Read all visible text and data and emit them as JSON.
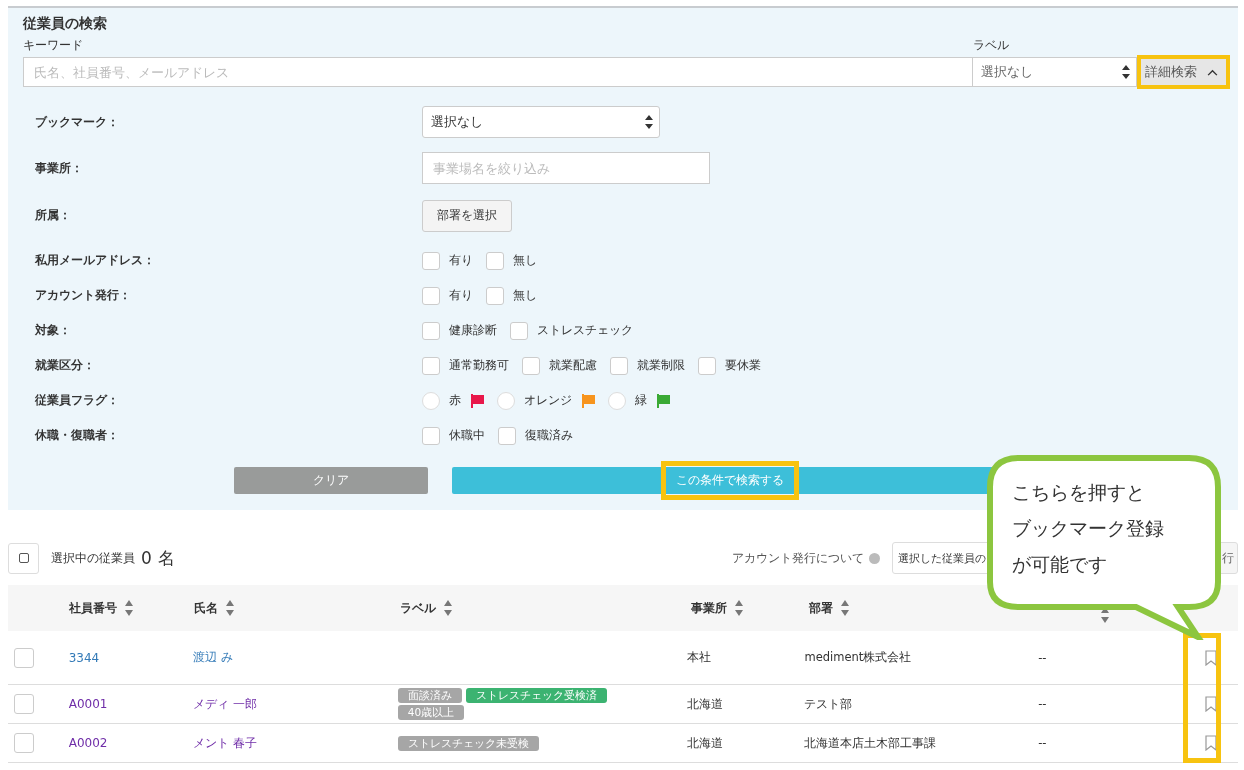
{
  "search_panel": {
    "title": "従業員の検索",
    "keyword": {
      "label": "キーワード",
      "placeholder": "氏名、社員番号、メールアドレス"
    },
    "label_filter": {
      "label": "ラベル",
      "value": "選択なし"
    },
    "detail_toggle": {
      "label": "詳細検索",
      "expanded": true,
      "highlighted": true
    },
    "filters": [
      {
        "kind": "select",
        "label": "ブックマーク：",
        "value": "選択なし"
      },
      {
        "kind": "text",
        "label": "事業所：",
        "placeholder": "事業場名を絞り込み"
      },
      {
        "kind": "button",
        "label": "所属：",
        "button": "部署を選択"
      },
      {
        "kind": "checkboxes",
        "label": "私用メールアドレス：",
        "options": [
          {
            "label": "有り",
            "checked": false
          },
          {
            "label": "無し",
            "checked": false
          }
        ]
      },
      {
        "kind": "checkboxes",
        "label": "アカウント発行：",
        "options": [
          {
            "label": "有り",
            "checked": false
          },
          {
            "label": "無し",
            "checked": false
          }
        ]
      },
      {
        "kind": "checkboxes",
        "label": "対象：",
        "options": [
          {
            "label": "健康診断",
            "checked": false
          },
          {
            "label": "ストレスチェック",
            "checked": false
          }
        ]
      },
      {
        "kind": "checkboxes",
        "label": "就業区分：",
        "options": [
          {
            "label": "通常勤務可",
            "checked": false
          },
          {
            "label": "就業配慮",
            "checked": false
          },
          {
            "label": "就業制限",
            "checked": false
          },
          {
            "label": "要休業",
            "checked": false
          }
        ]
      },
      {
        "kind": "radios",
        "label": "従業員フラグ：",
        "options": [
          {
            "label": "赤",
            "selected": false,
            "color": "#e8174a"
          },
          {
            "label": "オレンジ",
            "selected": false,
            "color": "#f7941d"
          },
          {
            "label": "緑",
            "selected": false,
            "color": "#3aaa35"
          }
        ]
      },
      {
        "kind": "checkboxes",
        "label": "休職・復職者：",
        "options": [
          {
            "label": "休職中",
            "checked": false
          },
          {
            "label": "復職済み",
            "checked": false
          }
        ]
      }
    ],
    "clear_button": "クリア",
    "search_button": {
      "label": "この条件で検索する",
      "highlighted": true
    }
  },
  "results": {
    "select_all_checked": false,
    "selected_label": "選択中の従業員",
    "selected_count": "0",
    "selected_unit": "名",
    "account_help": "アカウント発行について",
    "bulk_select": "選択した従業員の",
    "bulk_button": "行",
    "table": {
      "bookmark_highlighted": true,
      "columns": [
        {
          "label": "社員番号",
          "sortable": true
        },
        {
          "label": "氏名",
          "sortable": true
        },
        {
          "label": "ラベル",
          "sortable": true
        },
        {
          "label": "事業所",
          "sortable": true
        },
        {
          "label": "部署",
          "sortable": true
        },
        {
          "sortable": true
        }
      ],
      "rows": [
        {
          "checked": false,
          "id": "3344",
          "name": "渡辺 み",
          "visited": false,
          "labels": [],
          "office": "本社",
          "department": "mediment株式会社",
          "column_7": "--",
          "bookmarked": false
        },
        {
          "checked": false,
          "id": "A0001",
          "name": "メディ 一郎",
          "visited": true,
          "labels": [
            {
              "text": "面談済み",
              "color": "#a6a6a6"
            },
            {
              "text": "ストレスチェック受検済",
              "color": "#3cb371"
            },
            {
              "text": "40歳以上",
              "color": "#a6a6a6"
            }
          ],
          "office": "北海道",
          "department": "テスト部",
          "column_7": "--",
          "bookmarked": false
        },
        {
          "checked": false,
          "id": "A0002",
          "name": "メント 春子",
          "visited": true,
          "labels": [
            {
              "text": "ストレスチェック未受検",
              "color": "#a6a6a6"
            }
          ],
          "office": "北海道",
          "department": "北海道本店土木部工事課",
          "column_7": "--",
          "bookmarked": false
        }
      ]
    }
  },
  "callout": {
    "lines": [
      "こちらを押すと",
      "ブックマーク登録",
      "が可能です"
    ]
  }
}
